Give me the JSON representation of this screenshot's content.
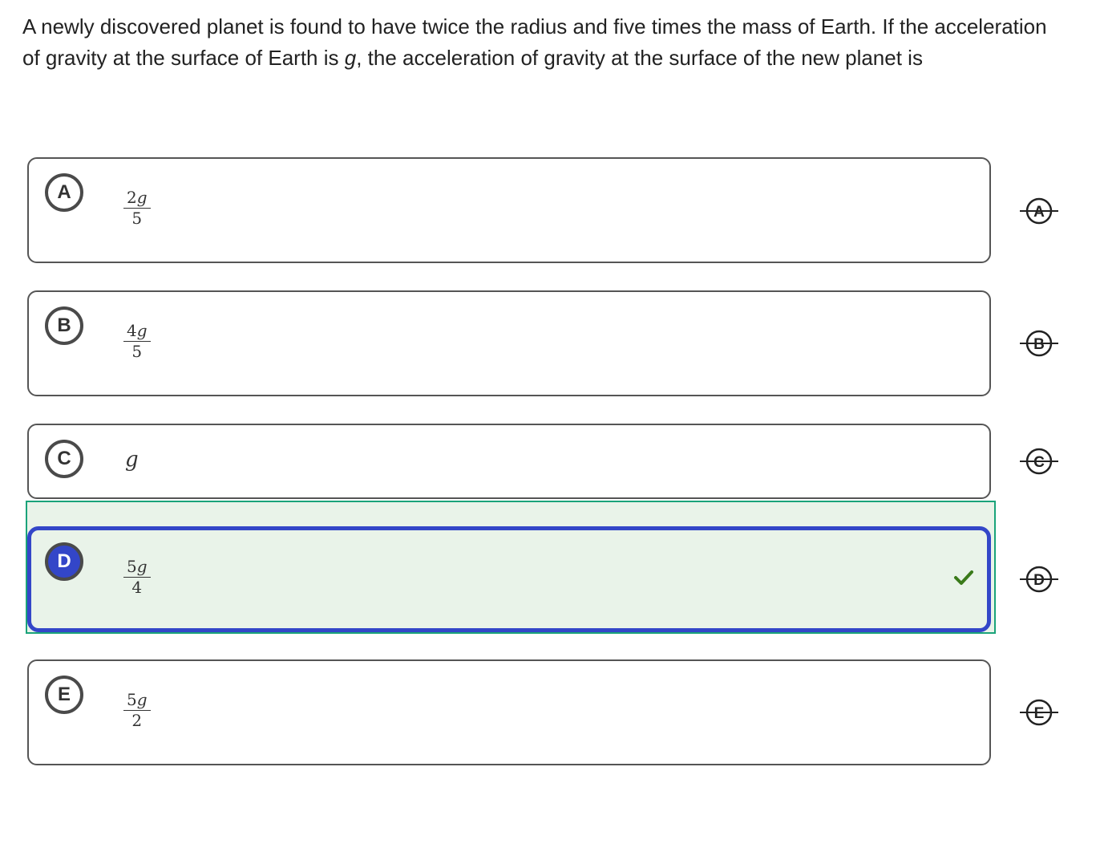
{
  "question": {
    "part1": "A newly discovered planet is found to have twice the radius and five times the mass of Earth. If the acceleration of gravity at the surface of Earth is ",
    "var": "g",
    "part2": ", the acceleration of gravity at the surface of the new planet is"
  },
  "choices": [
    {
      "letter": "A",
      "num_coef": "2",
      "num_var": "g",
      "den": "5"
    },
    {
      "letter": "B",
      "num_coef": "4",
      "num_var": "g",
      "den": "5"
    },
    {
      "letter": "C",
      "value": "g"
    },
    {
      "letter": "D",
      "num_coef": "5",
      "num_var": "g",
      "den": "4",
      "selected": true,
      "correct": true
    },
    {
      "letter": "E",
      "num_coef": "5",
      "num_var": "g",
      "den": "2"
    }
  ],
  "colors": {
    "selected_border": "#3346c8",
    "correct_frame": "#1aa37a",
    "correct_bg": "#e9f3e9",
    "check": "#3a7a1a"
  },
  "icons": {
    "check": "checkmark-icon",
    "strike": "strikethrough-letter-icon"
  }
}
